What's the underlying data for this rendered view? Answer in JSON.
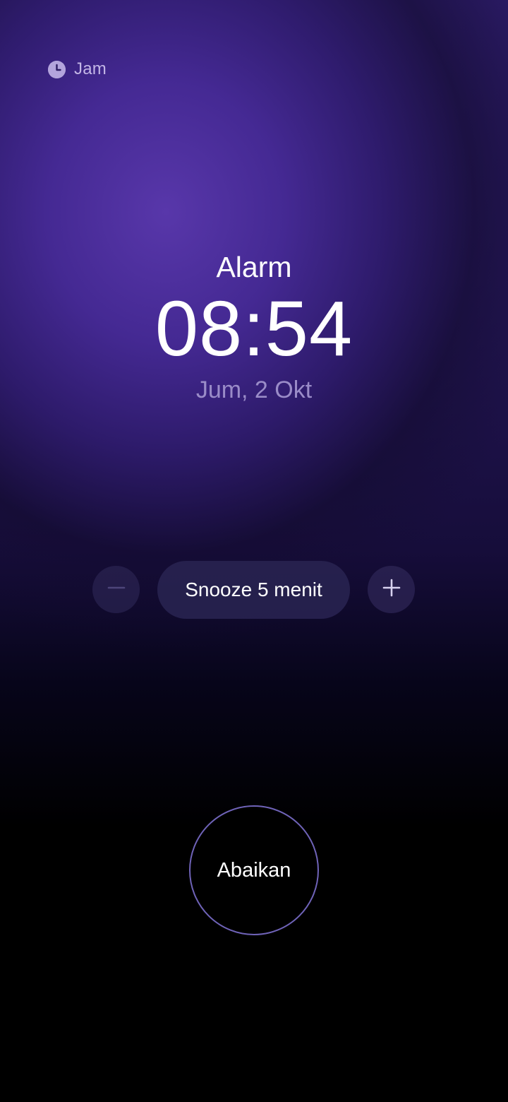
{
  "app": {
    "name": "Jam",
    "icon": "clock-icon"
  },
  "alarm": {
    "title": "Alarm",
    "time": "08:54",
    "date": "Jum, 2 Okt"
  },
  "snooze": {
    "label": "Snooze 5 menit",
    "decrease_icon": "minus-icon",
    "increase_icon": "plus-icon"
  },
  "dismiss": {
    "label": "Abaikan"
  },
  "colors": {
    "accent": "#6f63b8",
    "background_top": "#4a2f9a",
    "background_bottom": "#000000",
    "date_text": "#9a8cc8"
  }
}
